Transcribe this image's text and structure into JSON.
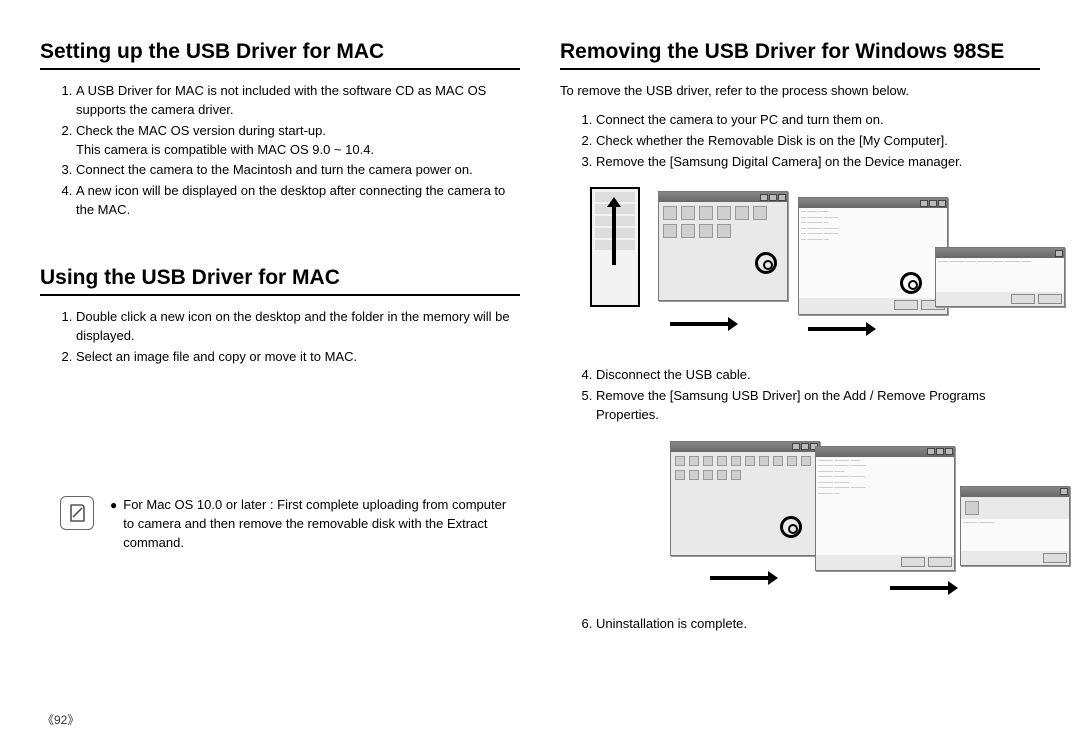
{
  "page_number": "《92》",
  "left": {
    "section1": {
      "title": "Setting up the USB Driver for MAC",
      "items": [
        "A USB Driver for MAC is not included with the software CD as MAC OS supports the camera driver.",
        "Check the MAC OS version during start-up.",
        "Connect the camera to the Macintosh and turn the camera power on.",
        "A new icon will be displayed on the desktop after connecting the camera to the MAC."
      ],
      "item2_sub": "This camera is compatible with MAC OS 9.0 ~ 10.4."
    },
    "section2": {
      "title": "Using the USB Driver for MAC",
      "items": [
        "Double click a new icon on the desktop and the folder in the memory will be displayed.",
        "Select an image file and copy or move it to MAC."
      ]
    },
    "note": {
      "label": "For Mac OS 10.0 or later : ",
      "text": "First complete uploading from computer to camera and then remove the removable disk with the Extract command."
    }
  },
  "right": {
    "section": {
      "title": "Removing the USB Driver for Windows 98SE",
      "intro": "To remove the USB driver, refer to the process shown below.",
      "items_a": [
        "Connect the camera to your PC and turn them on.",
        "Check whether the Removable Disk is on the [My Computer].",
        "Remove the [Samsung Digital Camera] on the Device manager."
      ],
      "items_b": [
        "Disconnect the USB cable.",
        "Remove the [Samsung USB Driver] on the Add / Remove Programs Properties."
      ],
      "items_c": [
        "Uninstallation is complete."
      ]
    }
  }
}
